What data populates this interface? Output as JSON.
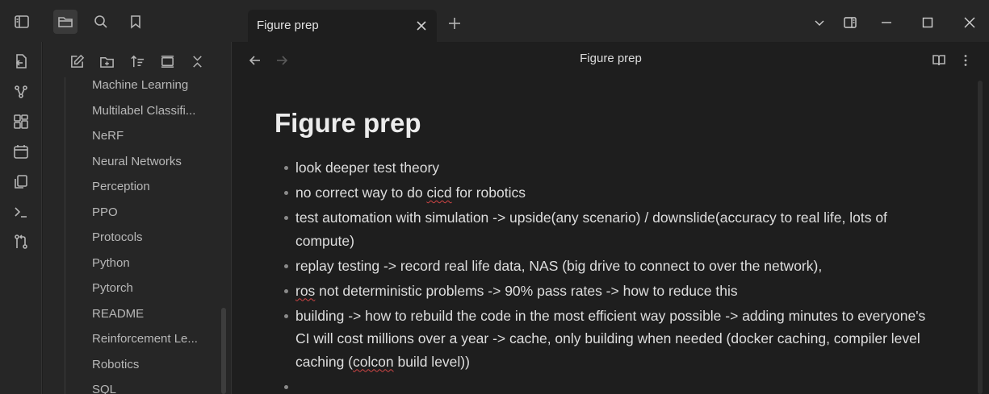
{
  "tab": {
    "title": "Figure prep"
  },
  "view_header": {
    "title": "Figure prep"
  },
  "sidebar": {
    "items": [
      "Machine Learning",
      "Multilabel Classifi...",
      "NeRF",
      "Neural Networks",
      "Perception",
      "PPO",
      "Protocols",
      "Python",
      "Pytorch",
      "README",
      "Reinforcement Le...",
      "Robotics",
      "SQL"
    ]
  },
  "note": {
    "title": "Figure prep",
    "bullets": [
      {
        "parts": [
          {
            "text": "look deeper test theory",
            "spell": false
          }
        ]
      },
      {
        "parts": [
          {
            "text": "no correct way to do ",
            "spell": false
          },
          {
            "text": "cicd",
            "spell": true
          },
          {
            "text": " for robotics",
            "spell": false
          }
        ]
      },
      {
        "parts": [
          {
            "text": "test automation with simulation -> upside(any scenario) /  downslide(accuracy to real life, lots of compute)",
            "spell": false
          }
        ]
      },
      {
        "parts": [
          {
            "text": "replay testing -> record real life data, NAS (big drive to connect to over the network),",
            "spell": false
          }
        ]
      },
      {
        "parts": [
          {
            "text": "ros",
            "spell": true
          },
          {
            "text": " not deterministic problems -> 90% pass rates -> how to reduce this",
            "spell": false
          }
        ]
      },
      {
        "parts": [
          {
            "text": "building -> how to rebuild the code in the most efficient way possible -> adding minutes to everyone's CI will cost millions over a year -> cache, only building when needed (docker caching, compiler level caching (",
            "spell": false
          },
          {
            "text": "colcon",
            "spell": true
          },
          {
            "text": " build level))",
            "spell": false
          }
        ]
      },
      {
        "parts": [
          {
            "text": "",
            "spell": false
          }
        ]
      }
    ]
  },
  "icons": {
    "titlebar": [
      "sidebar-toggle-icon",
      "folder-icon",
      "search-icon",
      "bookmark-icon"
    ],
    "sidebar_tools": [
      "new-note-icon",
      "new-folder-icon",
      "sort-icon",
      "collapse-view-icon",
      "collapse-all-icon"
    ],
    "ribbon": [
      "quick-switcher-icon",
      "graph-view-icon",
      "canvas-icon",
      "daily-note-icon",
      "templates-icon",
      "command-palette-icon",
      "git-icon"
    ],
    "window": [
      "chevron-down-icon",
      "right-sidebar-toggle-icon",
      "minimize-icon",
      "maximize-icon",
      "close-icon"
    ],
    "view": [
      "back-arrow-icon",
      "forward-arrow-icon",
      "reading-view-icon",
      "more-options-icon"
    ]
  },
  "colors": {
    "background": "#1e1e1e",
    "chrome": "#262626",
    "spellcheck": "#d04545"
  }
}
